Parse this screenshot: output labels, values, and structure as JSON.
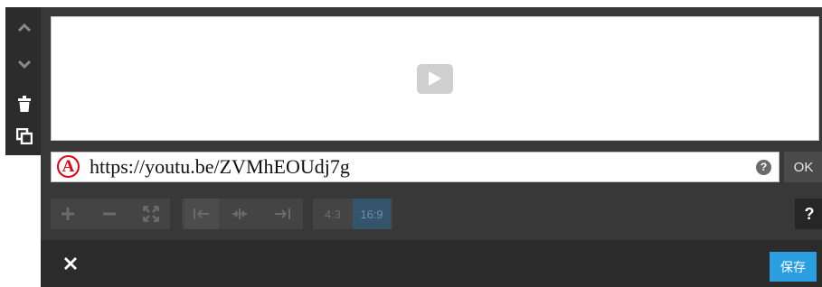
{
  "toolbar": {
    "items": [
      {
        "icon": "chevron-up-icon"
      },
      {
        "icon": "chevron-down-icon"
      },
      {
        "icon": "trash-icon"
      },
      {
        "icon": "duplicate-icon"
      }
    ]
  },
  "preview": {
    "icon": "play-icon"
  },
  "url": {
    "annotation": "A",
    "value": "https://youtu.be/ZVMhEOUdj7g",
    "help": "?",
    "ok_label": "OK"
  },
  "controls": {
    "ratio_4_3": "4:3",
    "ratio_16_9": "16:9",
    "active_ratio": "16:9",
    "help": "?"
  },
  "footer": {
    "close_icon": "close-icon",
    "save_label": "保存"
  },
  "colors": {
    "accent": "#2b9ee0",
    "annotation": "#e60012",
    "panel": "#383838"
  }
}
